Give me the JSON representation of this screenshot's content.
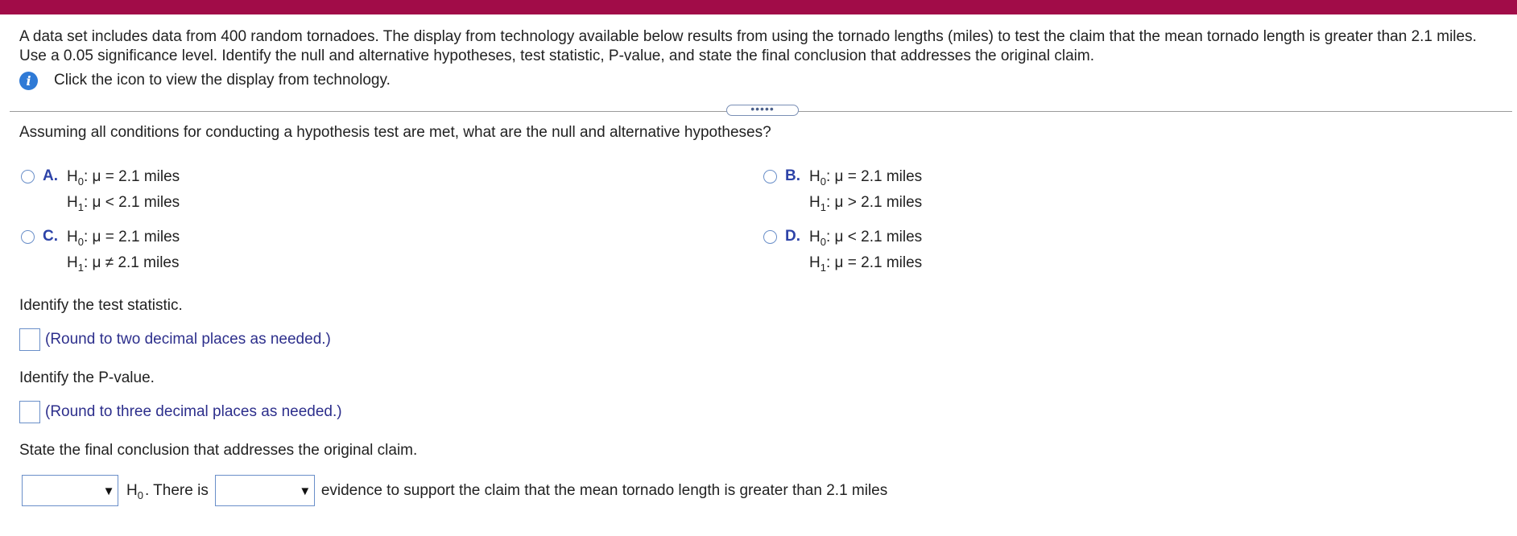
{
  "header_color": "#a10c48",
  "problem_text": "A data set includes data from 400 random tornadoes. The display from technology available below results from using the tornado lengths (miles) to test the claim that the mean tornado length is greater than 2.1 miles. Use a 0.05 significance level. Identify the null and alternative hypotheses, test statistic, P-value, and state the final conclusion that addresses the original claim.",
  "info": {
    "icon": "info-icon",
    "text": "Click the icon to view the display from technology."
  },
  "expander_label": "•••••",
  "question": "Assuming all conditions for conducting a hypothesis test are met, what are the null and alternative hypotheses?",
  "options": [
    {
      "letter": "A.",
      "h0_prefix": "H",
      "h0_sub": "0",
      "h0_rest": ": μ = 2.1 miles",
      "h1_prefix": "H",
      "h1_sub": "1",
      "h1_rest": ": μ < 2.1 miles"
    },
    {
      "letter": "B.",
      "h0_prefix": "H",
      "h0_sub": "0",
      "h0_rest": ": μ = 2.1 miles",
      "h1_prefix": "H",
      "h1_sub": "1",
      "h1_rest": ": μ > 2.1 miles"
    },
    {
      "letter": "C.",
      "h0_prefix": "H",
      "h0_sub": "0",
      "h0_rest": ": μ = 2.1 miles",
      "h1_prefix": "H",
      "h1_sub": "1",
      "h1_rest": ": μ ≠ 2.1 miles"
    },
    {
      "letter": "D.",
      "h0_prefix": "H",
      "h0_sub": "0",
      "h0_rest": ": μ < 2.1 miles",
      "h1_prefix": "H",
      "h1_sub": "1",
      "h1_rest": ": μ = 2.1 miles"
    }
  ],
  "test_statistic": {
    "label": "Identify the test statistic.",
    "hint": "(Round to two decimal places as needed.)",
    "value": ""
  },
  "p_value": {
    "label": "Identify the P-value.",
    "hint": "(Round to three decimal places as needed.)",
    "value": ""
  },
  "conclusion": {
    "label": "State the final conclusion that addresses the original claim.",
    "dropdown1_value": "",
    "h0_prefix": "H",
    "h0_sub": "0",
    "mid_text": ". There is",
    "dropdown2_value": "",
    "tail_text": "evidence to support the claim that the mean tornado length is greater than 2.1 miles",
    "arrow_glyph": "▼"
  }
}
